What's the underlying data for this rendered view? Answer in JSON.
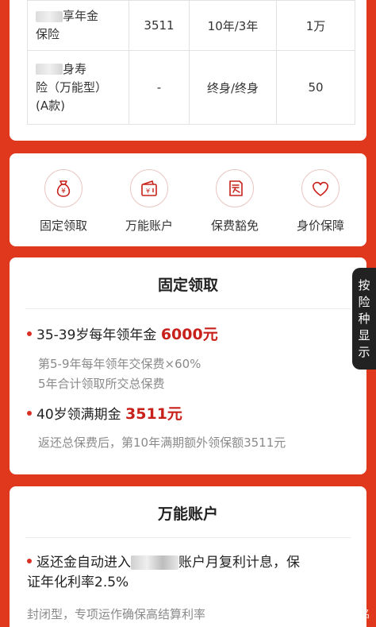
{
  "table": {
    "rows": [
      {
        "name_line1": "享年金",
        "name_line2": "保险",
        "col2": "3511",
        "col3": "10年/3年",
        "col4": "1万"
      },
      {
        "name_line1": "身寿",
        "name_line2": "险（万能型）",
        "name_line3": "(A款)",
        "col2": "-",
        "col3": "终身/终身",
        "col4": "50"
      }
    ]
  },
  "features": [
    {
      "label": "固定领取",
      "icon": "money-bag-icon"
    },
    {
      "label": "万能账户",
      "icon": "wallet-icon"
    },
    {
      "label": "保费豁免",
      "icon": "exemption-icon"
    },
    {
      "label": "身价保障",
      "icon": "heart-icon"
    }
  ],
  "fixed_section": {
    "title": "固定领取",
    "item1": {
      "text": "35-39岁每年领年金",
      "amount": "6000元"
    },
    "item1_sub1": "第5-9年每年领年交保费×60%",
    "item1_sub2": "5年合计领取所交总保费",
    "item2": {
      "text": "40岁领满期金",
      "amount": "3511元"
    },
    "item2_sub": "返还总保费后，第10年满期额外领保额3511元"
  },
  "universal_section": {
    "title": "万能账户",
    "item1_part1": "返还金自动进入",
    "item1_part2": "账户月复利计息，保",
    "item1_line2": "证年化利率2.5%",
    "item1_sub": "封闭型，专项运作确保高结算利率"
  },
  "side_tab": {
    "chars": [
      "按",
      "险",
      "种",
      "显",
      "示"
    ]
  },
  "watermark": "知乎 @小洺",
  "colors": {
    "background": "#e0381d",
    "accent": "#c8201a",
    "bullet": "#d93025"
  }
}
